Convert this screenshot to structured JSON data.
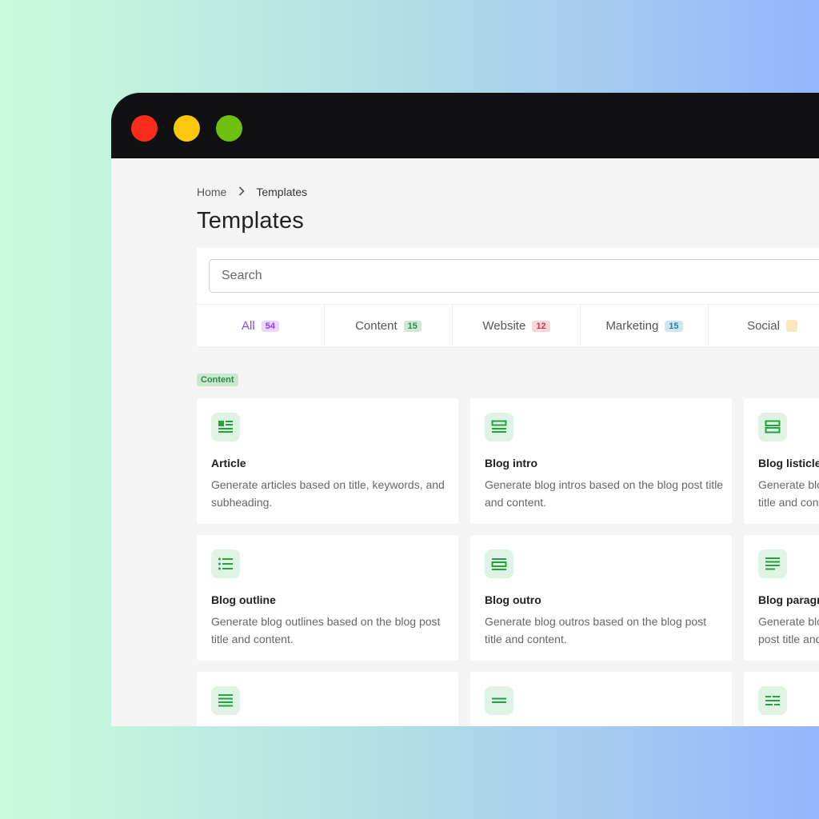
{
  "window": {
    "controls": [
      {
        "name": "close",
        "color": "#fb2c1a"
      },
      {
        "name": "minimize",
        "color": "#fdc70f"
      },
      {
        "name": "maximize",
        "color": "#6ec10e"
      }
    ]
  },
  "breadcrumb": {
    "home": "Home",
    "separator": "›",
    "current": "Templates"
  },
  "page_title": "Templates",
  "search": {
    "placeholder": "Search",
    "value": ""
  },
  "tabs": [
    {
      "label": "All",
      "count": "54",
      "active": true,
      "count_bg": "#ead7fd",
      "count_color": "#8b3ff0"
    },
    {
      "label": "Content",
      "count": "15",
      "active": false,
      "count_bg": "#cde9d4",
      "count_color": "#2f8a45"
    },
    {
      "label": "Website",
      "count": "12",
      "active": false,
      "count_bg": "#fbd4d8",
      "count_color": "#c23a4a"
    },
    {
      "label": "Marketing",
      "count": "15",
      "active": false,
      "count_bg": "#cbe6f2",
      "count_color": "#2a7ca6"
    },
    {
      "label": "Social",
      "count": "",
      "active": false,
      "count_bg": "#fbe7b8",
      "count_color": "#a3760c"
    }
  ],
  "section": {
    "label": "Content"
  },
  "accent_green": "#22a33e",
  "cards": [
    {
      "title": "Article",
      "desc": "Generate articles based on title, keywords, and subheading.",
      "icon": "article-icon"
    },
    {
      "title": "Blog intro",
      "desc": "Generate blog intros based on the blog post title and content.",
      "icon": "blog-intro-icon"
    },
    {
      "title": "Blog listicle",
      "desc": "Generate blog listicles based on the blog post title and content.",
      "icon": "blog-listicle-icon"
    },
    {
      "title": "Blog outline",
      "desc": "Generate blog outlines based on the blog post title and content.",
      "icon": "list-icon"
    },
    {
      "title": "Blog outro",
      "desc": "Generate blog outros based on the blog post title and content.",
      "icon": "blog-outro-icon"
    },
    {
      "title": "Blog paragraph",
      "desc": "Generate blog paragraphs based on the blog post title and content.",
      "icon": "paragraph-icon"
    },
    {
      "title": "",
      "desc": "",
      "icon": "text-lines-icon"
    },
    {
      "title": "",
      "desc": "",
      "icon": "equals-icon"
    },
    {
      "title": "",
      "desc": "",
      "icon": "text-blocks-icon"
    }
  ]
}
